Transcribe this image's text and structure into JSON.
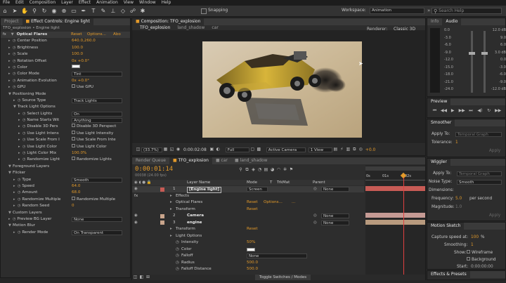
{
  "menu": [
    "File",
    "Edit",
    "Composition",
    "Layer",
    "Effect",
    "Animation",
    "View",
    "Window",
    "Help"
  ],
  "toolbar": {
    "snapping_label": "Snapping",
    "workspace_label": "Workspace:",
    "workspace_value": "Animation",
    "search_placeholder": "Search Help"
  },
  "left_panel": {
    "tab_project": "Project",
    "tab_effect_controls": "Effect Controls: Engine light",
    "breadcrumb": "TFO_explosion • Engine light",
    "effect_name": "Optical Flares",
    "reset_label": "Reset",
    "options_label": "Options...",
    "about_label": "Abo",
    "properties": [
      {
        "name": "Center Position",
        "value": "640.0,260.0",
        "indent": 1
      },
      {
        "name": "Brightness",
        "value": "100.0",
        "indent": 1
      },
      {
        "name": "Scale",
        "value": "100.0",
        "indent": 1
      },
      {
        "name": "Rotation Offset",
        "value": "0x +0.0°",
        "indent": 1
      },
      {
        "name": "Color",
        "value": "",
        "indent": 1,
        "swatch": true
      },
      {
        "name": "Color Mode",
        "value": "Tint",
        "indent": 1,
        "dropdown": true
      },
      {
        "name": "Animation Evolution",
        "value": "0x +0.0°",
        "indent": 1
      },
      {
        "name": "GPU",
        "value": "Use GPU",
        "indent": 1,
        "check": true
      },
      {
        "name": "Positioning Mode",
        "value": "",
        "indent": 1,
        "group": true
      },
      {
        "name": "Source Type",
        "value": "Track Lights",
        "indent": 2,
        "dropdown": true
      },
      {
        "name": "Track Light Options",
        "value": "",
        "indent": 2,
        "group": true
      },
      {
        "name": "Select Lights",
        "value": "On",
        "indent": 3,
        "dropdown": true
      },
      {
        "name": "Name Starts Wit",
        "value": "Anything",
        "indent": 3,
        "dropdown": true
      },
      {
        "name": "Disable 3D Pers",
        "value": "Disable 3D Perspect",
        "indent": 3,
        "check": true
      },
      {
        "name": "Use Light Intens",
        "value": "Use Light Intensity",
        "indent": 3,
        "check": true
      },
      {
        "name": "Use Scale From I",
        "value": "Use Scale From Inte",
        "indent": 3,
        "check": true
      },
      {
        "name": "Use Light Color",
        "value": "Use Light Color",
        "indent": 3,
        "check": true
      },
      {
        "name": "Light Color Mix",
        "value": "100.0%",
        "indent": 3
      },
      {
        "name": "Randomize Light",
        "value": "Randomize Lights",
        "indent": 3,
        "check": true
      },
      {
        "name": "Foreground Layers",
        "value": "",
        "indent": 1,
        "group": true
      },
      {
        "name": "Flicker",
        "value": "",
        "indent": 1,
        "group": true
      },
      {
        "name": "Type",
        "value": "Smooth",
        "indent": 2,
        "dropdown": true
      },
      {
        "name": "Speed",
        "value": "64.0",
        "indent": 2
      },
      {
        "name": "Amount",
        "value": "68.0",
        "indent": 2
      },
      {
        "name": "Randomize Multiple",
        "value": "Randomize Multiple",
        "indent": 2,
        "check": true
      },
      {
        "name": "Random Seed",
        "value": "0",
        "indent": 2
      },
      {
        "name": "Custom Layers",
        "value": "",
        "indent": 1,
        "group": true
      },
      {
        "name": "Preview BG Layer",
        "value": "None",
        "indent": 1,
        "dropdown": true
      },
      {
        "name": "Motion Blur",
        "value": "",
        "indent": 1,
        "group": true
      },
      {
        "name": "Render Mode",
        "value": "On Transparent",
        "indent": 2,
        "dropdown": true
      }
    ]
  },
  "composition": {
    "title": "Composition: TFO_explosion",
    "tabs": [
      "TFO_explosion",
      "land_shadow",
      "car"
    ],
    "renderer_label": "Renderer:",
    "renderer_value": "Classic 3D",
    "zoom": "(33.7%)",
    "timecode": "0:00:02:08",
    "resolution": "Full",
    "camera": "Active Camera",
    "views": "1 View",
    "exposure": "+0.0"
  },
  "timeline": {
    "tab_render_queue": "Render Queue",
    "tabs": [
      "TFO_explosion",
      "car",
      "land_shadow"
    ],
    "current_time": "0:00:01:14",
    "frame_info": "00038 (24.00 fps)",
    "col_layer_name": "Layer Name",
    "col_mode": "Mode",
    "col_t": "T",
    "col_trkmat": "TrkMat",
    "col_parent": "Parent",
    "ruler_start": "0s",
    "ruler_marks": [
      "01s",
      "02s"
    ],
    "toggle_label": "Toggle Switches / Modes",
    "rows": [
      {
        "num": "1",
        "name": "[Engine light]",
        "mode": "Screen",
        "parent": "None",
        "kind": "layer",
        "sel": true
      },
      {
        "name": "Effects",
        "kind": "group"
      },
      {
        "name": "Optical Flares",
        "reset": "Reset",
        "options": "Options...",
        "extra": "...",
        "kind": "effect"
      },
      {
        "name": "Transform",
        "reset": "Reset",
        "kind": "group"
      },
      {
        "num": "2",
        "name": "Camera",
        "parent": "None",
        "kind": "layer"
      },
      {
        "num": "3",
        "name": "engine",
        "parent": "None",
        "kind": "layer"
      },
      {
        "name": "Transform",
        "reset": "Reset",
        "kind": "group"
      },
      {
        "name": "Light Options",
        "kind": "group"
      },
      {
        "name": "Intensity",
        "value": "50%",
        "kind": "prop"
      },
      {
        "name": "Color",
        "value": "",
        "kind": "prop",
        "swatch": true
      },
      {
        "name": "Falloff",
        "value": "None",
        "kind": "prop",
        "dropdown": true
      },
      {
        "name": "Radius",
        "value": "500.0",
        "kind": "prop"
      },
      {
        "name": "Falloff Distance",
        "value": "500.0",
        "kind": "prop"
      }
    ]
  },
  "info_panel": {
    "tab_info": "Info",
    "tab_audio": "Audio",
    "db_left": [
      "0.0",
      "-3.0",
      "-6.0",
      "-9.0",
      "-12.0",
      "-15.0",
      "-18.0",
      "-21.0",
      "-24.0"
    ],
    "db_right": [
      "12.0 dB",
      "9.0",
      "6.0",
      "3.0 dB",
      "0.0",
      "-3.0",
      "-6.0",
      "-9.0",
      "-12.0 dB"
    ]
  },
  "preview_panel": {
    "title": "Preview"
  },
  "smoother_panel": {
    "title": "Smoother",
    "apply_to_label": "Apply To:",
    "apply_to_value": "Temporal Graph",
    "tolerance_label": "Tolerance:",
    "tolerance_value": "1",
    "apply_btn": "Apply"
  },
  "wiggler_panel": {
    "title": "Wiggler",
    "apply_to_label": "Apply To:",
    "apply_to_value": "Temporal Graph",
    "noise_label": "Noise Type:",
    "noise_value": "Smooth",
    "dimensions_label": "Dimensions:",
    "frequency_label": "Frequency:",
    "frequency_value": "5.0",
    "frequency_unit": "per second",
    "magnitude_label": "Magnitude:",
    "magnitude_value": "1.0",
    "apply_btn": "Apply"
  },
  "motion_sketch_panel": {
    "title": "Motion Sketch",
    "capture_label": "Capture speed at:",
    "capture_value": "100",
    "capture_unit": "%",
    "smoothing_label": "Smoothing:",
    "smoothing_value": "1",
    "show_label": "Show:",
    "wireframe_label": "Wireframe",
    "background_label": "Background",
    "start_label": "Start:",
    "start_value": "0:00:00:00"
  },
  "effects_presets_panel": {
    "title": "Effects & Presets"
  },
  "colors": {
    "accent_orange": "#e39a2a",
    "layer_red": "#c75b55",
    "layer_pink": "#c59a94",
    "layer_tan": "#b89a7e",
    "playhead": "#e04040"
  }
}
